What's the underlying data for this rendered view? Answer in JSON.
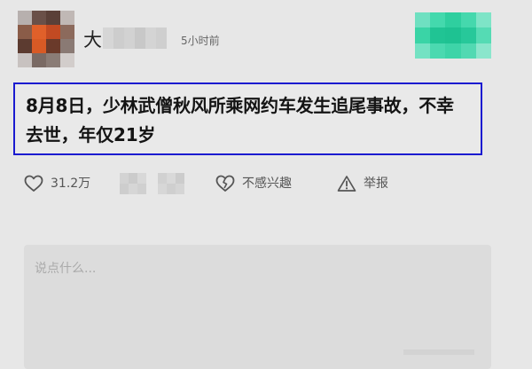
{
  "post": {
    "author_name": "大",
    "timestamp": "5小时前",
    "content": "8月8日，少林武僧秋风所乘网约车发生追尾事故，不幸去世，年仅21岁"
  },
  "actions": {
    "like_count": "31.2万",
    "dislike_label": "不感兴趣",
    "report_label": "举报"
  },
  "comment": {
    "placeholder": "说点什么..."
  },
  "colors": {
    "page_background": "#e7e7e7",
    "highlight_border": "#1b1bd0",
    "follow_button": "#3bd6aa"
  },
  "icons": {
    "like": "heart-outline-icon",
    "dislike": "broken-heart-icon",
    "report": "warning-triangle-icon"
  }
}
